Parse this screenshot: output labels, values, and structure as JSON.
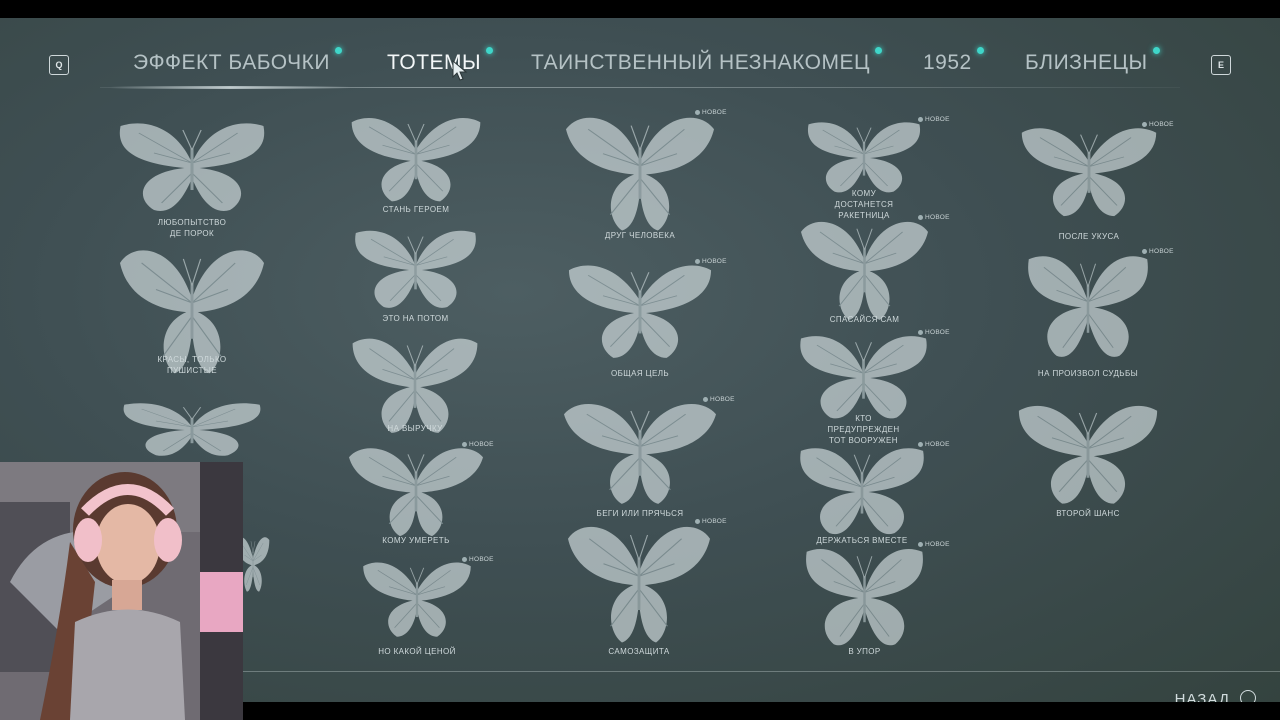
{
  "nav": {
    "prev_key": "Q",
    "next_key": "E",
    "tabs": [
      {
        "label": "ЭФФЕКТ БАБОЧКИ",
        "active": false
      },
      {
        "label": "ТОТЕМЫ",
        "active": true
      },
      {
        "label": "ТАИНСТВЕННЫЙ НЕЗНАКОМЕЦ",
        "active": false
      },
      {
        "label": "1952",
        "active": false
      },
      {
        "label": "БЛИЗНЕЦЫ",
        "active": false
      }
    ]
  },
  "badge_text": "НОВОЕ",
  "totems": [
    {
      "label": "ЛЮБОПЫТСТВО ДЕ ПОРОК",
      "new": false
    },
    {
      "label": "СТАНЬ ГЕРОЕМ",
      "new": false
    },
    {
      "label": "ДРУГ ЧЕЛОВЕКА",
      "new": true
    },
    {
      "label": "КОМУ ДОСТАНЕТСЯ РАКЕТНИЦА",
      "new": true
    },
    {
      "label": "ПОСЛЕ УКУСА",
      "new": true
    },
    {
      "label": "КРАСЫ, ТОЛЬКО ПУШИСТЫЕ",
      "new": false
    },
    {
      "label": "ЭТО НА ПОТОМ",
      "new": false
    },
    {
      "label": "ОБЩАЯ ЦЕЛЬ",
      "new": true
    },
    {
      "label": "СПАСАЙСЯ САМ",
      "new": true
    },
    {
      "label": "НА ПРОИЗВОЛ СУДЬБЫ",
      "new": true
    },
    {
      "label": "НА ВЫРУЧКУ",
      "new": false
    },
    {
      "label": "БЕГИ ИЛИ ПРЯЧЬСЯ",
      "new": true
    },
    {
      "label": "КТО ПРЕДУПРЕЖДЕН ТОТ ВООРУЖЕН",
      "new": true
    },
    {
      "label": "ВТОРОЙ ШАНС",
      "new": false
    },
    {
      "label": "КОМУ УМЕРЕТЬ",
      "new": true
    },
    {
      "label": "ДЕРЖАТЬСЯ ВМЕСТЕ",
      "new": true
    },
    {
      "label": "НО КАКОЙ ЦЕНОЙ",
      "new": true
    },
    {
      "label": "САМОЗАЩИТА",
      "new": true
    },
    {
      "label": "В УПОР",
      "new": true
    }
  ],
  "back_label": "НАЗАД",
  "colors": {
    "background": "#415155",
    "accent_dot": "#3fd6c9",
    "butterfly": "#dfe9eb"
  },
  "icons": {
    "tab_new": "teal-dot",
    "back": "circle-button-icon",
    "cursor": "mouse-cursor-icon"
  }
}
